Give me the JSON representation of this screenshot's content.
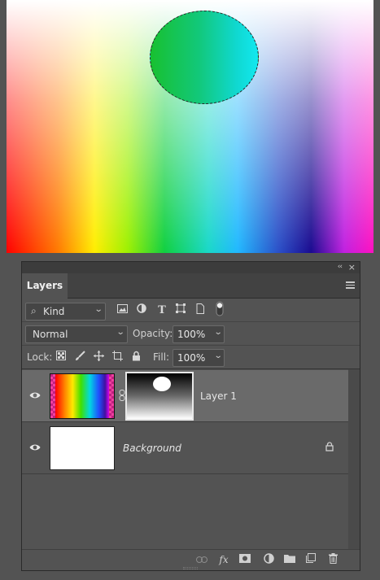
{
  "canvas": {
    "selection": "ellipse-marquee"
  },
  "panel": {
    "tab_label": "Layers",
    "collapse_label": "‹‹",
    "close_label": "×",
    "filter": {
      "kind_label": "Kind",
      "icons": [
        "image-filter-icon",
        "adjustment-filter-icon",
        "type-filter-icon",
        "shape-filter-icon",
        "smart-object-filter-icon",
        "filter-toggle-icon"
      ]
    },
    "blend": {
      "mode": "Normal",
      "opacity_label": "Opacity:",
      "opacity_value": "100%"
    },
    "lock": {
      "label": "Lock:",
      "fill_label": "Fill:",
      "fill_value": "100%",
      "icons": [
        "lock-transparent-pixels-icon",
        "lock-image-pixels-icon",
        "lock-position-icon",
        "lock-artboard-icon",
        "lock-all-icon"
      ]
    },
    "layers": [
      {
        "name": "Layer 1",
        "selected": true,
        "visible": true,
        "has_mask": true
      },
      {
        "name": "Background",
        "selected": false,
        "visible": true,
        "locked": true
      }
    ],
    "footer_icons": [
      "link-layers-icon",
      "fx-icon",
      "add-mask-icon",
      "adjustment-layer-icon",
      "new-group-icon",
      "new-layer-icon",
      "delete-layer-icon"
    ],
    "fx_label": "fx"
  }
}
